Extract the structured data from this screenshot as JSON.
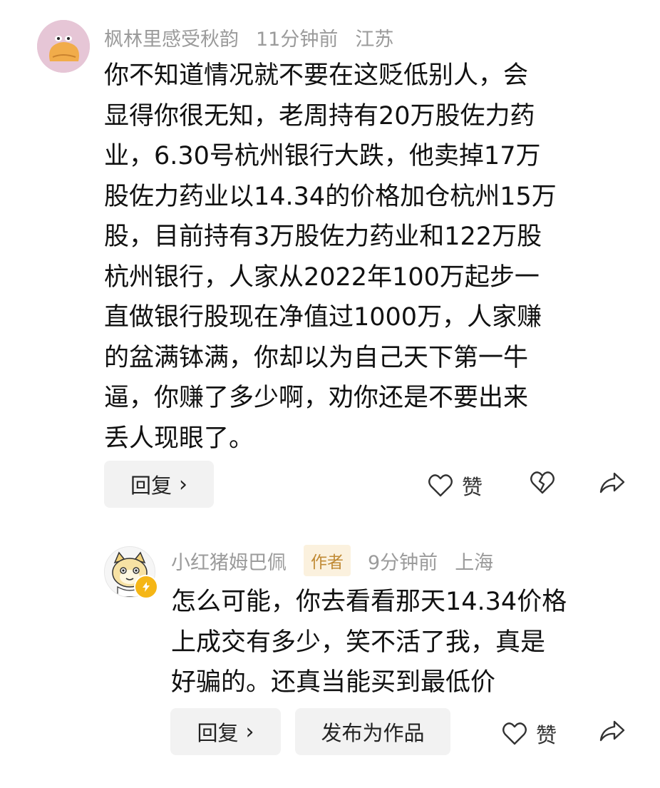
{
  "comments": [
    {
      "username": "枫林里感受秋韵",
      "time": "11分钟前",
      "location": "江苏",
      "text": "你不知道情况就不要在这贬低别人，会\n显得你很无知，老周持有20万股佐力药\n业，6.30号杭州银行大跌，他卖掉17万\n股佐力药业以14.34的价格加仓杭州15万\n股，目前持有3万股佐力药业和122万股\n杭州银行，人家从2022年100万起步一\n直做银行股现在净值过1000万，人家赚\n的盆满钵满，你却以为自己天下第一牛\n逼，你赚了多少啊，劝你还是不要出来\n丢人现眼了。",
      "reply_label": "回复",
      "reply_chevron": "›",
      "like_label": "赞"
    },
    {
      "username": "小红猪姆巴佩",
      "author_tag": "作者",
      "time": "9分钟前",
      "location": "上海",
      "text": "怎么可能，你去看看那天14.34价格\n上成交有多少，笑不活了我，真是\n好骗的。还真当能买到最低价",
      "reply_label": "回复",
      "reply_chevron": "›",
      "publish_label": "发布为作品",
      "like_label": "赞"
    }
  ],
  "icons": {
    "like": "heart-outline-icon",
    "dislike": "broken-heart-icon",
    "share": "share-arrow-icon",
    "author_badge": "lightning-badge-icon"
  },
  "colors": {
    "meta_text": "#9b9b9b",
    "author_tag_bg": "#fbf1de",
    "author_tag_text": "#c08a35",
    "badge": "#f5b616",
    "pill_bg": "#f2f2f2"
  }
}
